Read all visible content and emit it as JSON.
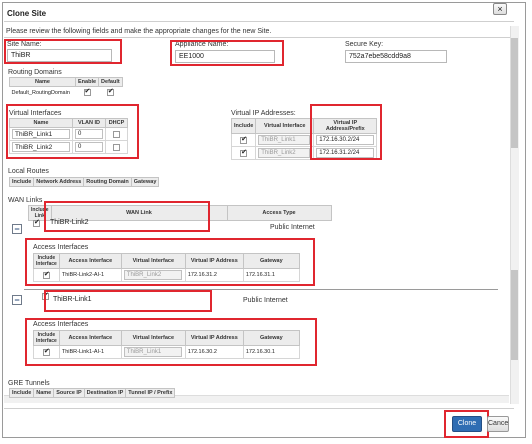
{
  "dialog": {
    "title": "Clone Site",
    "close_label": "×",
    "intro": "Please review the following fields and make the appropriate changes for the new Site."
  },
  "fields": {
    "site_name_label": "Site Name:",
    "site_name_value": "ThiBR",
    "appliance_name_label": "Appliance Name:",
    "appliance_name_value": "EE1000",
    "secure_key_label": "Secure Key:",
    "secure_key_value": "752a7ebe58cdd9a8"
  },
  "routing_domains": {
    "label": "Routing Domains",
    "headers": [
      "Name",
      "Enable",
      "Default"
    ],
    "rows": [
      {
        "name": "Default_RoutingDomain",
        "enable": true,
        "default": true
      }
    ]
  },
  "virtual_interfaces": {
    "label": "Virtual Interfaces",
    "headers": [
      "Name",
      "VLAN ID",
      "DHCP"
    ],
    "rows": [
      {
        "name": "ThiBR_Link1",
        "vlan": "0",
        "dhcp": false
      },
      {
        "name": "ThiBR_Link2",
        "vlan": "0",
        "dhcp": false
      }
    ]
  },
  "virtual_ip": {
    "label": "Virtual IP Addresses:",
    "headers": [
      "Include",
      "Virtual Interface",
      "Virtual IP Address/Prefix"
    ],
    "rows": [
      {
        "include": true,
        "interface": "ThiBR_Link1",
        "ip": "172.16.30.2/24"
      },
      {
        "include": true,
        "interface": "ThiBR_Link2",
        "ip": "172.16.31.2/24"
      }
    ]
  },
  "local_routes": {
    "label": "Local Routes",
    "headers": [
      "Include",
      "Network Address",
      "Routing Domain",
      "Gateway"
    ]
  },
  "wan_links": {
    "label": "WAN Links",
    "headers": [
      "Include Link",
      "WAN Link",
      "Access Type"
    ],
    "links": [
      {
        "name": "ThiBR-Link2",
        "access_type": "Public Internet",
        "collapse": "−",
        "ai_label": "Access Interfaces",
        "ai_headers": [
          "Include Interface",
          "Access Interface",
          "Virtual Interface",
          "Virtual IP Address",
          "Gateway"
        ],
        "ai_row": {
          "include": true,
          "access": "ThiBR-Link2-AI-1",
          "vif": "ThiBR_Link2",
          "ip": "172.16.31.2",
          "gw": "172.16.31.1"
        }
      },
      {
        "name": "ThiBR-Link1",
        "access_type": "Public Internet",
        "collapse": "−",
        "ai_label": "Access Interfaces",
        "ai_headers": [
          "Include Interface",
          "Access Interface",
          "Virtual Interface",
          "Virtual IP Address",
          "Gateway"
        ],
        "ai_row": {
          "include": true,
          "access": "ThiBR-Link1-AI-1",
          "vif": "ThiBR_Link1",
          "ip": "172.16.30.2",
          "gw": "172.16.30.1"
        }
      }
    ]
  },
  "gre_tunnels": {
    "label": "GRE Tunnels",
    "headers": [
      "Include",
      "Name",
      "Source IP",
      "Destination IP",
      "Tunnel IP / Prefix"
    ]
  },
  "buttons": {
    "clone": "Clone",
    "cancel": "Cancel"
  },
  "colors": {
    "highlight": "#e0262f",
    "primary_button": "#2f6db3"
  }
}
